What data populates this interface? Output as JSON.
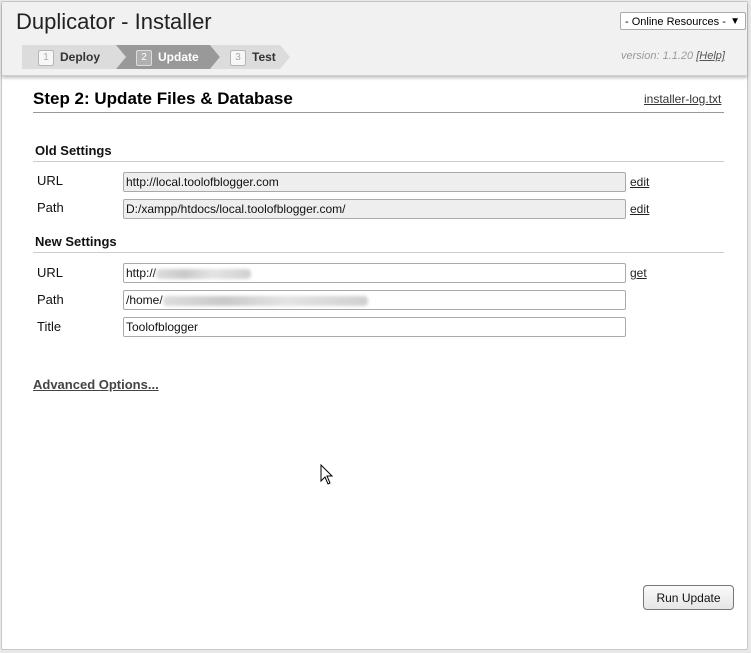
{
  "header": {
    "title": "Duplicator - Installer",
    "resources_label": "- Online Resources -",
    "version": "version: 1.1.20",
    "help_label": "[Help]"
  },
  "steps": [
    {
      "num": "1",
      "label": "Deploy",
      "state": "done"
    },
    {
      "num": "2",
      "label": "Update",
      "state": "active"
    },
    {
      "num": "3",
      "label": "Test",
      "state": "pending"
    }
  ],
  "main": {
    "heading": "Step 2: Update Files & Database",
    "log_link": "installer-log.txt"
  },
  "old_settings": {
    "title": "Old Settings",
    "url_label": "URL",
    "url_value": "http://local.toolofblogger.com",
    "url_action": "edit",
    "path_label": "Path",
    "path_value": "D:/xampp/htdocs/local.toolofblogger.com/",
    "path_action": "edit"
  },
  "new_settings": {
    "title": "New Settings",
    "url_label": "URL",
    "url_value": "http://",
    "url_action": "get",
    "path_label": "Path",
    "path_value": "/home/",
    "title_label": "Title",
    "title_value": "Toolofblogger"
  },
  "advanced_options": "Advanced Options...",
  "run_update": "Run Update",
  "colors": {
    "active_step": "#999999",
    "inactive_step": "#dcdcdc",
    "readonly_field": "#eeeeee"
  }
}
